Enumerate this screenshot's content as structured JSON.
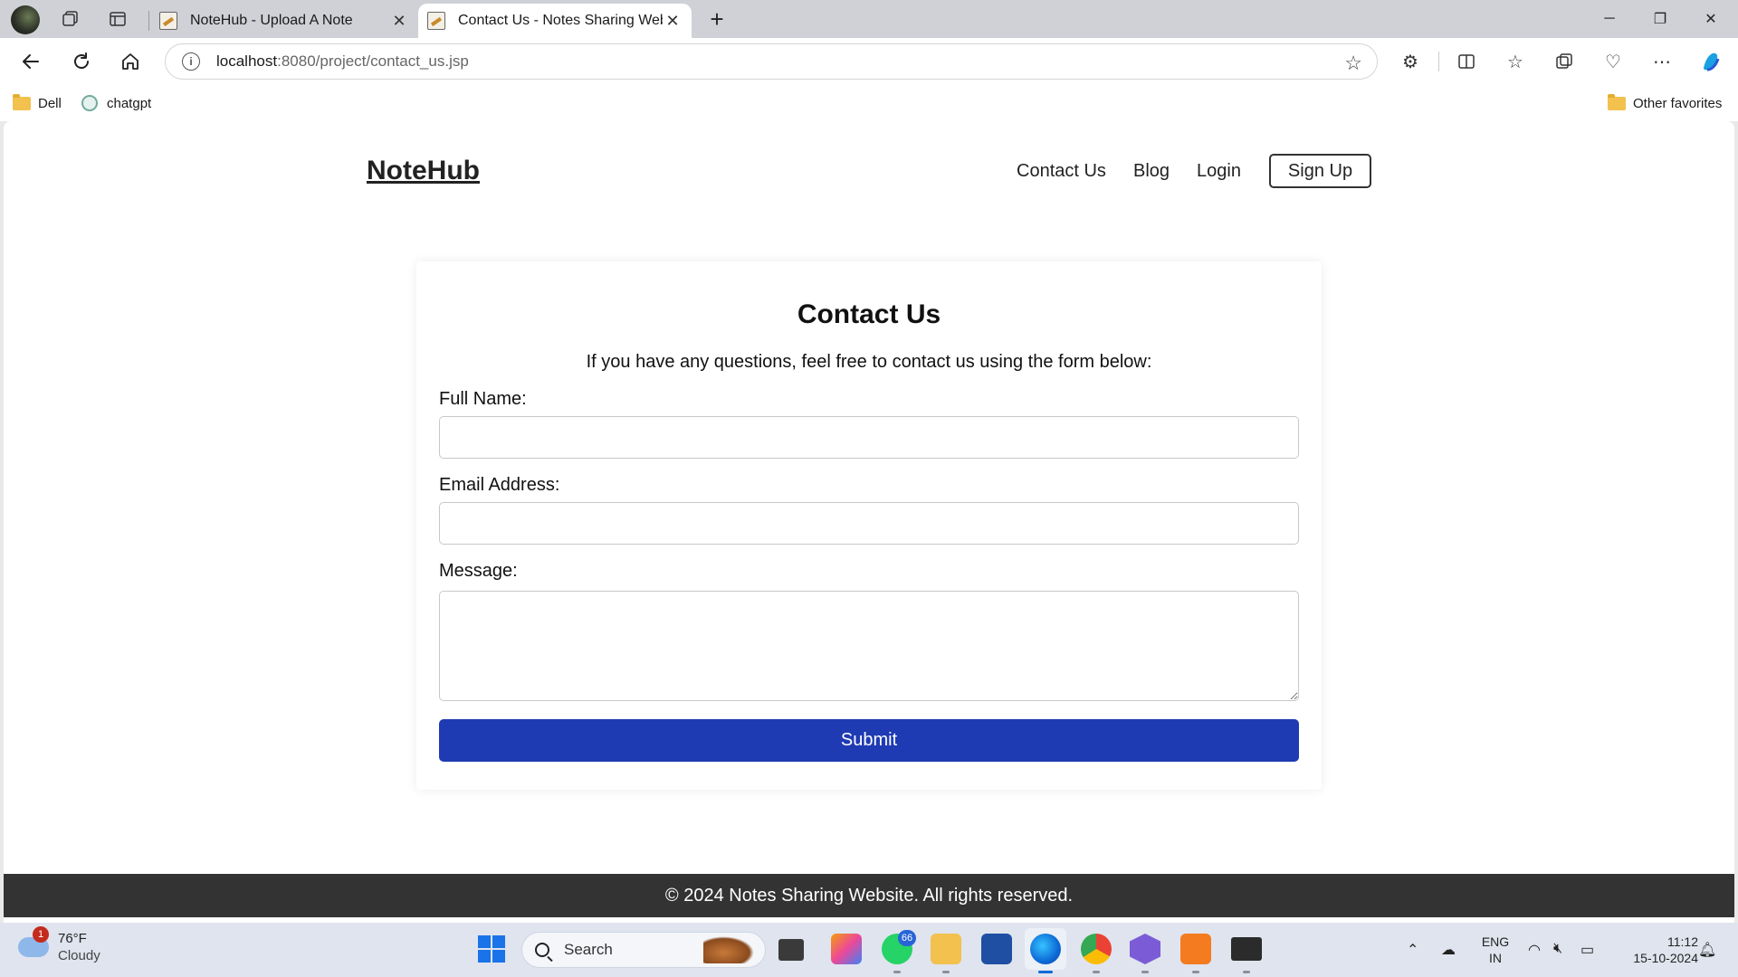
{
  "browser": {
    "tabs": [
      {
        "title": "NoteHub - Upload A Note",
        "active": false
      },
      {
        "title": "Contact Us - Notes Sharing Website",
        "active": true
      }
    ],
    "address": {
      "host": "localhost",
      "path": ":8080/project/contact_us.jsp"
    },
    "bookmarks": [
      {
        "label": "Dell",
        "icon": "folder-icon"
      },
      {
        "label": "chatgpt",
        "icon": "chatgpt-icon"
      }
    ],
    "other_favorites": "Other favorites"
  },
  "site": {
    "logo": "NoteHub",
    "nav": [
      "Contact Us",
      "Blog",
      "Login"
    ],
    "signup": "Sign Up"
  },
  "form": {
    "title": "Contact Us",
    "intro": "If you have any questions, feel free to contact us using the form below:",
    "full_name_label": "Full Name:",
    "full_name_value": "",
    "email_label": "Email Address:",
    "email_value": "",
    "message_label": "Message:",
    "message_value": "",
    "submit_label": "Submit"
  },
  "footer": {
    "text": "© 2024 Notes Sharing Website. All rights reserved."
  },
  "taskbar": {
    "weather_temp": "76°F",
    "weather_desc": "Cloudy",
    "weather_badge": "1",
    "search_label": "Search",
    "whatsapp_badge": "66",
    "language_top": "ENG",
    "language_bottom": "IN",
    "time": "11:12",
    "date": "15-10-2024"
  },
  "colors": {
    "submit_bg": "#1f3bb3",
    "footer_bg": "#333333"
  }
}
